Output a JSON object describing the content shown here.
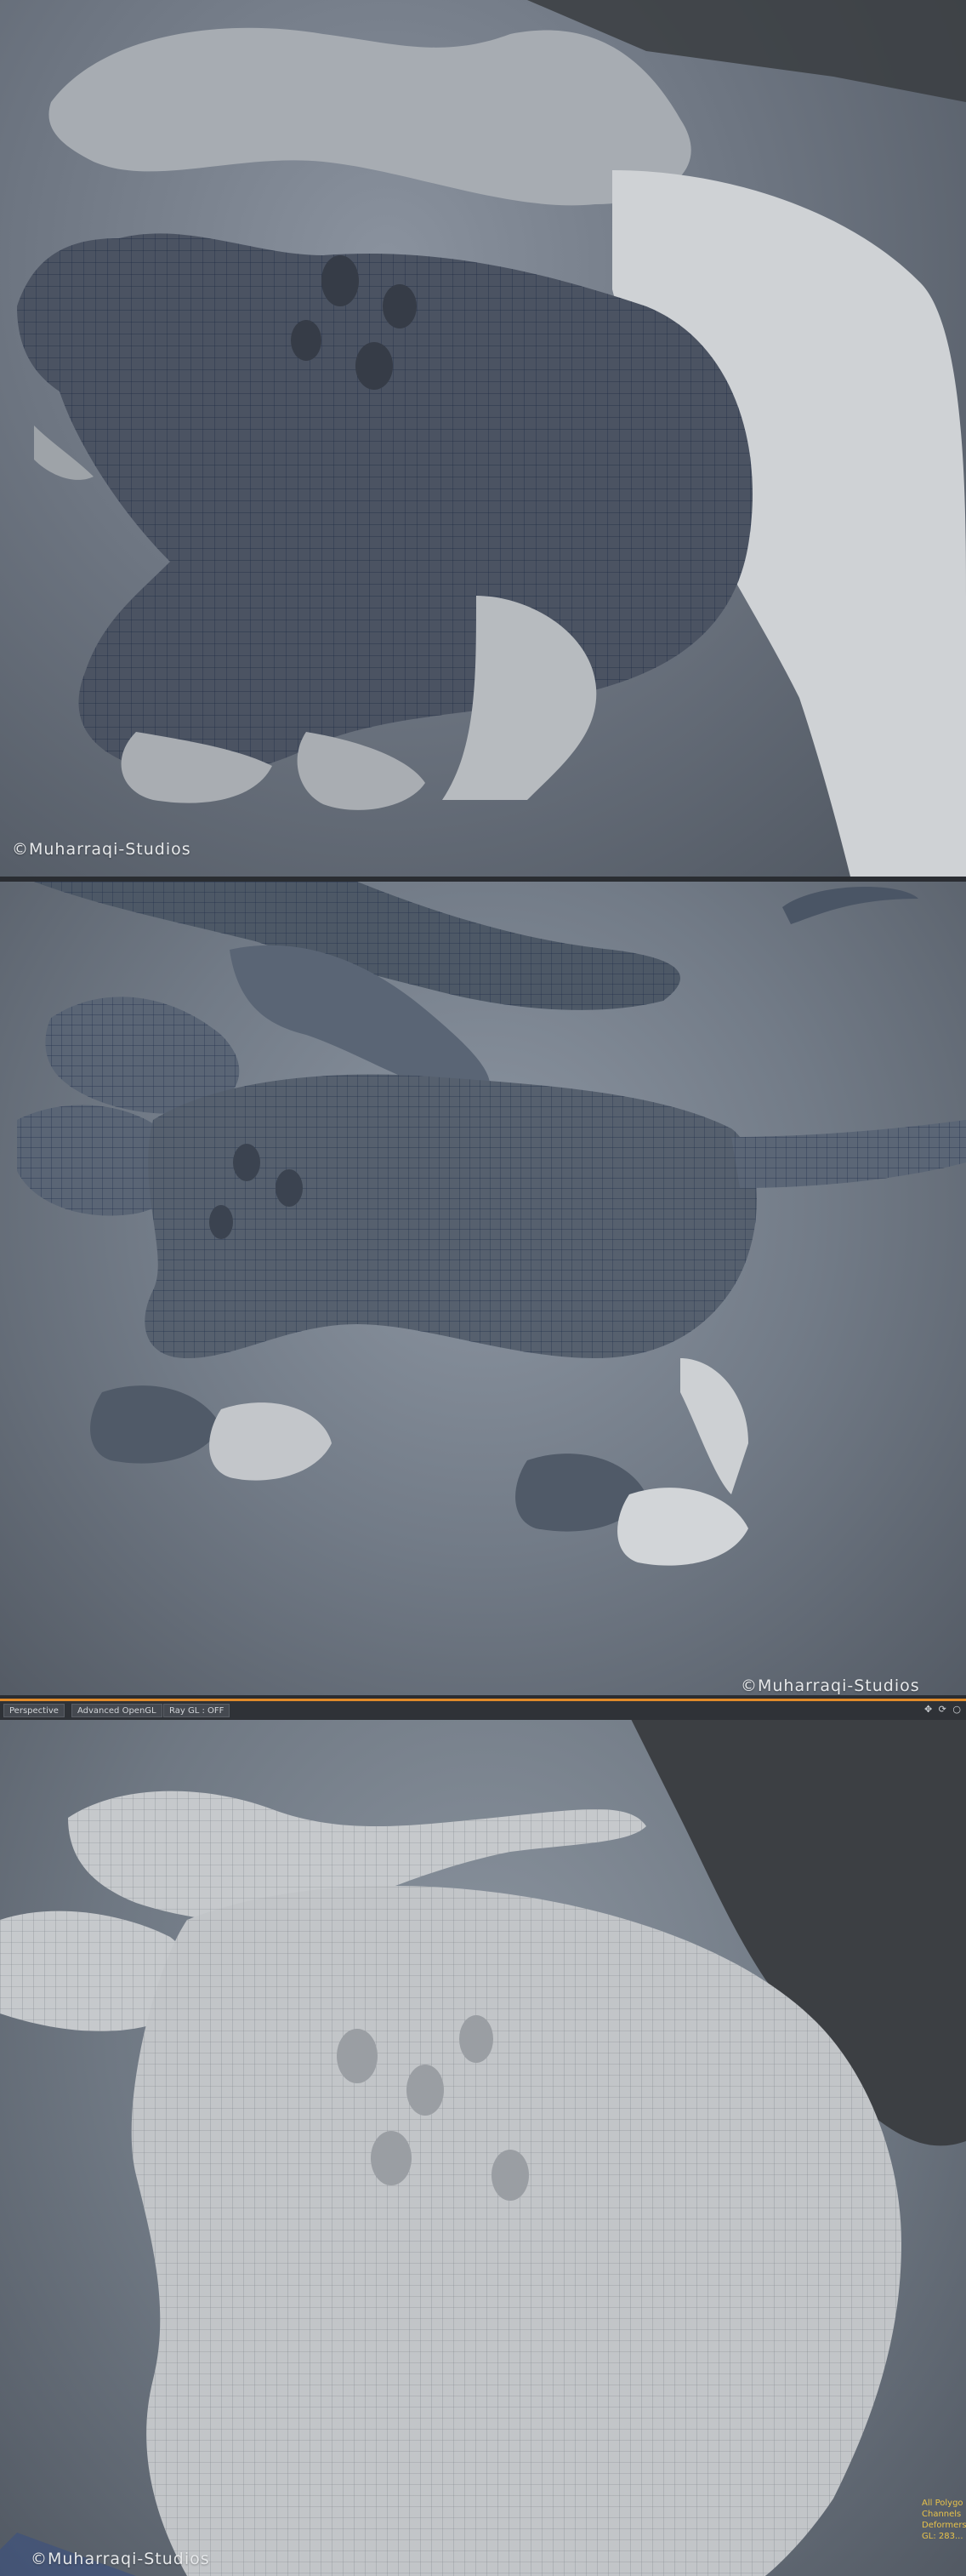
{
  "panels": [
    {
      "credit": "©Muharraqi-Studios"
    },
    {
      "credit": "©Muharraqi-Studios"
    },
    {
      "credit": "©Muharraqi-Studios"
    }
  ],
  "viewport": {
    "tabs": [
      "Perspective",
      "Advanced OpenGL",
      "Ray GL : OFF"
    ],
    "tools": {
      "move": "✥",
      "rotate": "⟳",
      "zoom": "○"
    },
    "hud": [
      "All Polygo",
      "Channels",
      "Deformers: OF",
      "GL: 283..."
    ]
  },
  "colors": {
    "accent": "#e08a2a",
    "hud": "#e8c24a",
    "wire": "#2b3f66"
  }
}
